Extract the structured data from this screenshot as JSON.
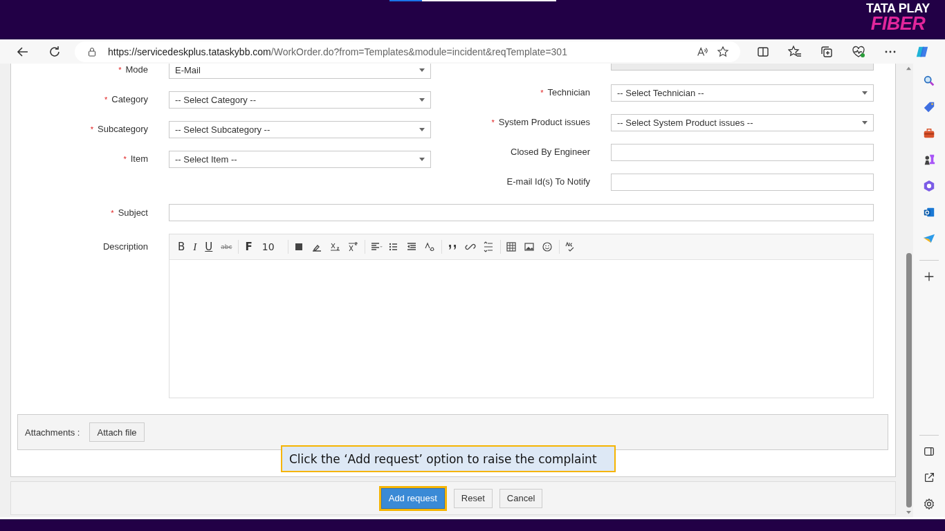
{
  "brand": {
    "line_1": "TATA PLAY",
    "line_2": "FIBER"
  },
  "browser": {
    "url_host": "https://servicedeskplus.tataskybb.com",
    "url_path": "/WorkOrder.do?from=Templates&module=incident&reqTemplate=301"
  },
  "form": {
    "left_fields": [
      {
        "label": "Mode",
        "required_mark": "*",
        "kind": "select",
        "value": "E-Mail"
      },
      {
        "label": "Category",
        "required_mark": "*",
        "kind": "select",
        "value": "-- Select Category --"
      },
      {
        "label": "Subcategory",
        "required_mark": "*",
        "kind": "select",
        "value": "-- Select Subcategory --"
      },
      {
        "label": "Item",
        "required_mark": "*",
        "kind": "select",
        "value": "-- Select Item --"
      }
    ],
    "right_fields": [
      {
        "kind": "readonly"
      },
      {
        "label": "Technician",
        "required_mark": "*",
        "kind": "select",
        "value": "-- Select Technician --"
      },
      {
        "label": "System Product issues",
        "required_mark": "*",
        "kind": "select",
        "value": "-- Select System Product issues --"
      },
      {
        "label": "Closed By Engineer",
        "kind": "text"
      },
      {
        "label": "E-mail Id(s) To Notify",
        "kind": "text"
      }
    ],
    "subject": {
      "label": "Subject",
      "required_mark": "*"
    },
    "description": {
      "label": "Description",
      "toolbar": [
        {
          "kind": "char",
          "text": "B"
        },
        {
          "kind": "char",
          "text": "I"
        },
        {
          "kind": "char",
          "text": "U"
        },
        {
          "kind": "char",
          "text": "abc"
        },
        {
          "kind": "sep"
        },
        {
          "kind": "char",
          "text": "F"
        },
        {
          "kind": "dropdown",
          "text": "10"
        },
        {
          "kind": "sep"
        },
        {
          "kind": "icon"
        },
        {
          "kind": "icon"
        },
        {
          "kind": "icon"
        },
        {
          "kind": "icon"
        },
        {
          "kind": "sep"
        },
        {
          "kind": "icon"
        },
        {
          "kind": "icon"
        },
        {
          "kind": "icon"
        },
        {
          "kind": "icon"
        },
        {
          "kind": "sep"
        },
        {
          "kind": "icon"
        },
        {
          "kind": "icon"
        },
        {
          "kind": "icon"
        },
        {
          "kind": "sep"
        },
        {
          "kind": "icon"
        },
        {
          "kind": "icon"
        },
        {
          "kind": "icon"
        },
        {
          "kind": "sep"
        },
        {
          "kind": "icon"
        }
      ]
    },
    "attachments": {
      "label": "Attachments :",
      "button": "Attach file"
    }
  },
  "callout": "Click the ‘Add request’ option to raise the complaint",
  "buttons": [
    {
      "label": "Add request",
      "primary": true,
      "highlighted": true
    },
    {
      "label": "Reset",
      "primary": false,
      "highlighted": false
    },
    {
      "label": "Cancel",
      "primary": false,
      "highlighted": false
    }
  ]
}
